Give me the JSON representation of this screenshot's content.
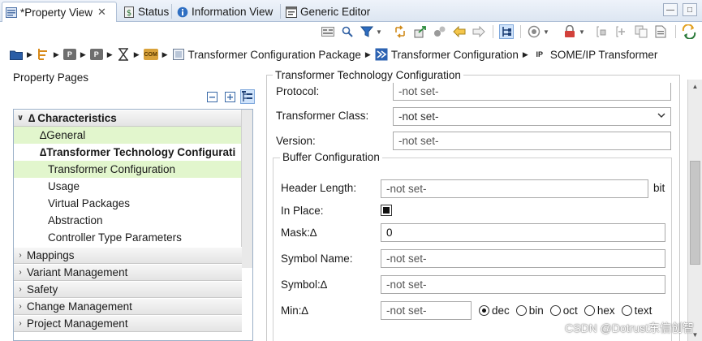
{
  "tabs": [
    {
      "label": "*Property View",
      "icon": "property-view-icon",
      "close": "✕",
      "active": true
    },
    {
      "label": "Status",
      "icon": "status-icon"
    },
    {
      "label": "Information View",
      "icon": "info-icon"
    },
    {
      "label": "Generic Editor",
      "icon": "editor-icon"
    }
  ],
  "window_buttons": {
    "minimize": "—",
    "maximize": "□"
  },
  "breadcrumb": {
    "items": [
      {
        "label": "Transformer Configuration Package",
        "icon": "package-icon"
      },
      {
        "label": "Transformer Configuration",
        "icon": "transformer-config-icon"
      },
      {
        "label": "SOME/IP Transformer",
        "icon": "ip-icon",
        "icon_text": "IP"
      }
    ],
    "short_icon_texts": [
      "P",
      "P",
      "COM"
    ]
  },
  "left": {
    "title": "Property Pages",
    "tree": [
      {
        "label": "Characteristics",
        "kind": "group",
        "expanded": true,
        "prefix": "∆"
      },
      {
        "label": "General",
        "prefix": "∆",
        "highlight": "green",
        "indent": 1
      },
      {
        "label": "Transformer Technology Configurati",
        "prefix": "∆",
        "bold": true,
        "indent": 1
      },
      {
        "label": "Transformer Configuration",
        "highlight": "green",
        "indent": 2
      },
      {
        "label": "Usage",
        "indent": 2
      },
      {
        "label": "Virtual Packages",
        "indent": 2
      },
      {
        "label": "Abstraction",
        "indent": 2
      },
      {
        "label": "Controller Type Parameters",
        "indent": 2
      },
      {
        "label": "Mappings",
        "kind": "group"
      },
      {
        "label": "Variant Management",
        "kind": "group"
      },
      {
        "label": "Safety",
        "kind": "group"
      },
      {
        "label": "Change Management",
        "kind": "group"
      },
      {
        "label": "Project Management",
        "kind": "group"
      }
    ]
  },
  "right": {
    "title": "Transformer Technology Configuration",
    "protocol": {
      "label": "Protocol:",
      "value": "-not set-"
    },
    "transformer_class": {
      "label": "Transformer Class:",
      "value": "-not set-"
    },
    "version": {
      "label": "Version:",
      "value": "-not set-"
    },
    "buffer": {
      "title": "Buffer Configuration",
      "header_length": {
        "label": "Header Length:",
        "value": "-not set-",
        "unit": "bit"
      },
      "in_place": {
        "label": "In Place:",
        "checked": true
      },
      "mask": {
        "label": "Mask:∆",
        "value": "0"
      },
      "symbol_name": {
        "label": "Symbol Name:",
        "value": "-not set-"
      },
      "symbol": {
        "label": "Symbol:∆",
        "value": "-not set-"
      },
      "min": {
        "label": "Min:∆",
        "value": "-not set-"
      },
      "radix": {
        "options": [
          "dec",
          "bin",
          "oct",
          "hex",
          "text"
        ],
        "selected": "dec"
      }
    }
  },
  "watermark": "CSDN @Dotrust东信创智"
}
